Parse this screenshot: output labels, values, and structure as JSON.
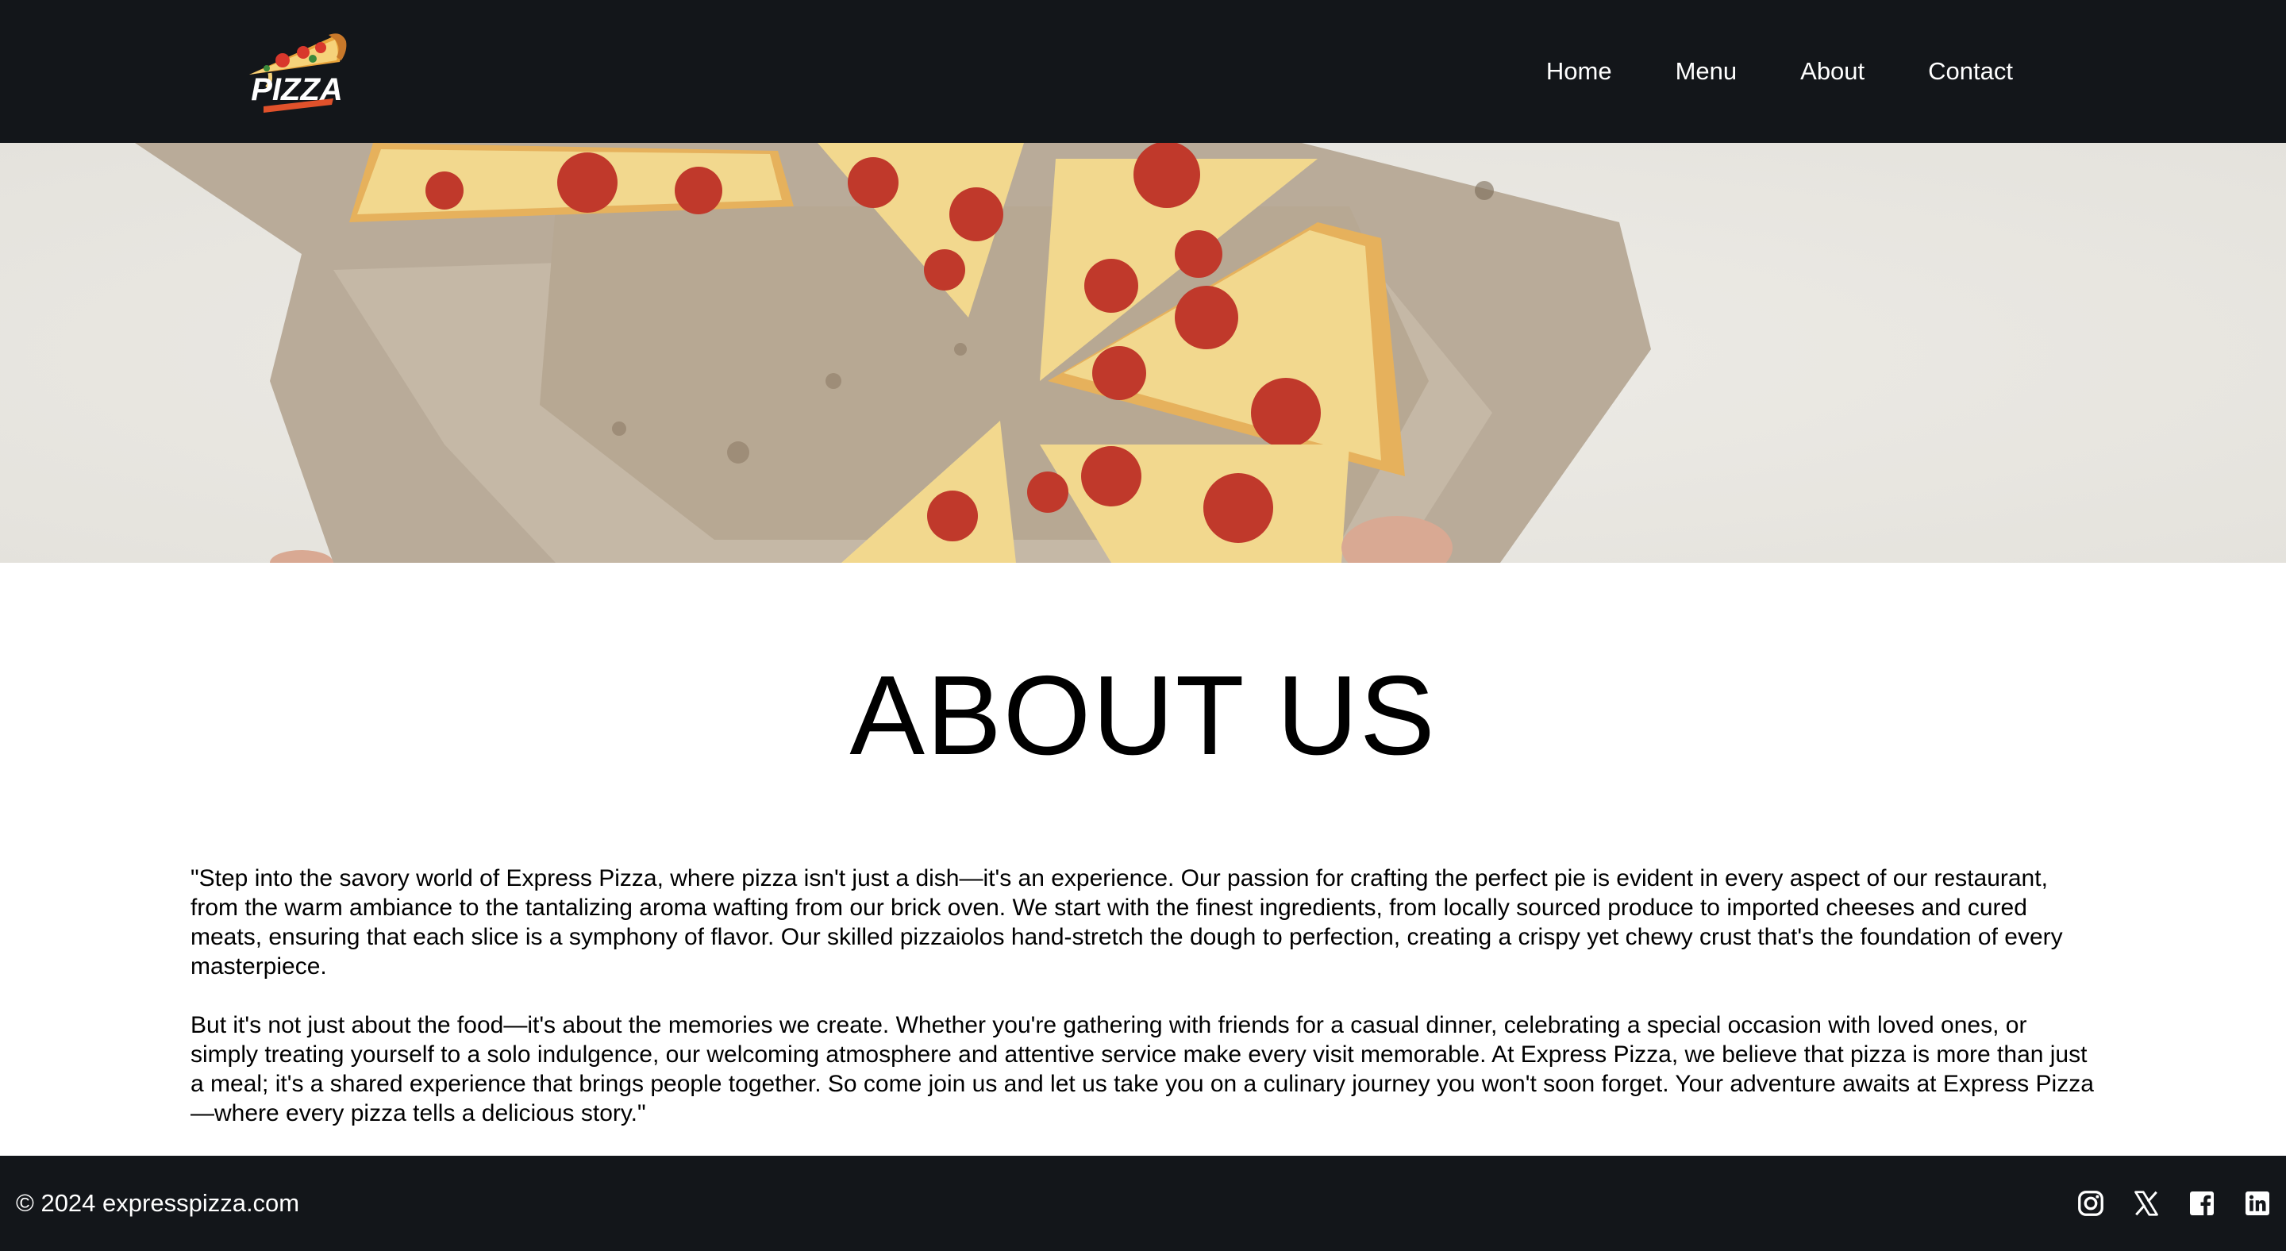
{
  "header": {
    "logo_text": "PIZZA",
    "nav": [
      {
        "label": "Home"
      },
      {
        "label": "Menu"
      },
      {
        "label": "About"
      },
      {
        "label": "Contact"
      }
    ]
  },
  "hero": {
    "image": "pizza-slices-in-box"
  },
  "main": {
    "title": "ABOUT US",
    "paragraphs": [
      "\"Step into the savory world of Express Pizza, where pizza isn't just a dish—it's an experience. Our passion for crafting the perfect pie is evident in every aspect of our restaurant, from the warm ambiance to the tantalizing aroma wafting from our brick oven. We start with the finest ingredients, from locally sourced produce to imported cheeses and cured meats, ensuring that each slice is a symphony of flavor. Our skilled pizzaiolos hand-stretch the dough to perfection, creating a crispy yet chewy crust that's the foundation of every masterpiece.",
      "But it's not just about the food—it's about the memories we create. Whether you're gathering with friends for a casual dinner, celebrating a special occasion with loved ones, or simply treating yourself to a solo indulgence, our welcoming atmosphere and attentive service make every visit memorable. At Express Pizza, we believe that pizza is more than just a meal; it's a shared experience that brings people together. So come join us and let us take you on a culinary journey you won't soon forget. Your adventure awaits at Express Pizza —where every pizza tells a delicious story.\""
    ]
  },
  "footer": {
    "copyright": "© 2024 expresspizza.com",
    "social": [
      "instagram-icon",
      "x-icon",
      "facebook-icon",
      "linkedin-icon"
    ]
  },
  "colors": {
    "header_bg": "#13161a",
    "footer_bg": "#13161a",
    "nav_text": "#ffffff",
    "body_text": "#000000"
  }
}
